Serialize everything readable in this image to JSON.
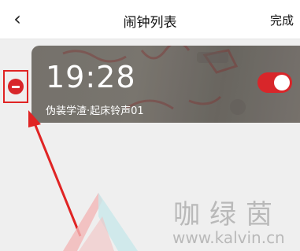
{
  "header": {
    "back_icon": "‹",
    "title": "闹钟列表",
    "done_label": "完成"
  },
  "alarm": {
    "time": "19:28",
    "subtitle": "伪装学渣·起床铃声01",
    "enabled": true
  },
  "watermark": {
    "name": "咖绿茵",
    "url": "www.kalvin.cn"
  },
  "colors": {
    "accent": "#d8262a",
    "annotation": "#e02424"
  }
}
